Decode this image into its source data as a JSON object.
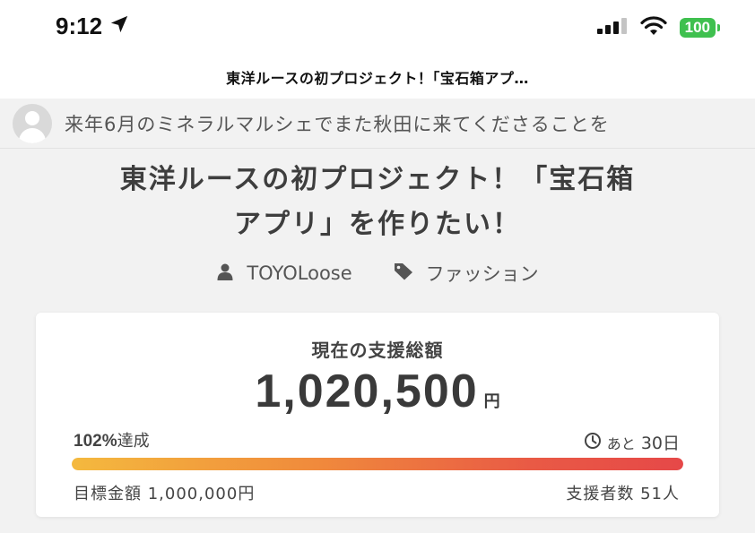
{
  "status_bar": {
    "time": "9:12",
    "battery": "100"
  },
  "nav": {
    "title": "東洋ルースの初プロジェクト！｢宝石箱アプ…"
  },
  "ticker": {
    "message": "来年6月のミネラルマルシェでまた秋田に来てくださることを"
  },
  "project": {
    "title_line1": "東洋ルースの初プロジェクト！「宝石箱",
    "title_line2": "アプリ」を作りたい！",
    "owner": "TOYOLoose",
    "category": "ファッション"
  },
  "funding": {
    "total_label": "現在の支援総額",
    "total_amount": "1,020,500",
    "currency_unit": "円",
    "achievement_percent": "102%",
    "achievement_suffix": "達成",
    "progress_fraction": 1.0,
    "remaining_prefix": "あと",
    "remaining_days": "30日",
    "goal_text": "目標金額 1,000,000円",
    "supporters_text": "支援者数 51人"
  },
  "colors": {
    "battery": "#3fc04f",
    "progress_start": "#f4b93e",
    "progress_end": "#e64848",
    "text_main": "#3e3e3e"
  },
  "icons": {
    "location": "location-arrow-icon",
    "signal": "cellular-signal-icon",
    "wifi": "wifi-icon",
    "user": "user-icon",
    "tag": "tag-icon",
    "clock": "clock-icon"
  }
}
